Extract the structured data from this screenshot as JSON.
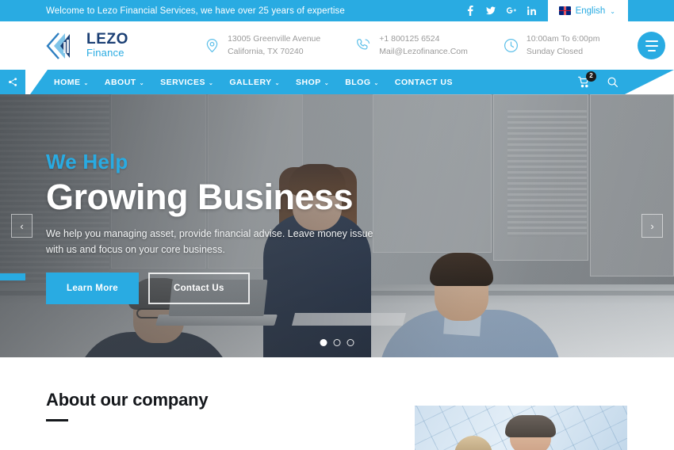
{
  "topbar": {
    "welcome": "Welcome to Lezo Financial Services, we have over 25 years of expertise",
    "social": [
      {
        "name": "facebook-icon",
        "label": "f"
      },
      {
        "name": "twitter-icon",
        "label": "t"
      },
      {
        "name": "google-plus-icon",
        "label": "g+"
      },
      {
        "name": "linkedin-icon",
        "label": "in"
      }
    ],
    "language": "English",
    "language_caret": "⌄",
    "accent_color": "#29ABE2"
  },
  "header": {
    "logo": {
      "name": "LEZO",
      "sub": "Finance"
    },
    "contacts": [
      {
        "icon": "location-pin-icon",
        "line1": "13005 Greenville Avenue",
        "line2": "California, TX 70240"
      },
      {
        "icon": "phone-icon",
        "line1": "+1 800125 6524",
        "line2": "Mail@Lezofinance.Com"
      },
      {
        "icon": "clock-icon",
        "line1": "10:00am To 6:00pm",
        "line2": "Sunday Closed"
      }
    ]
  },
  "nav": {
    "items": [
      {
        "label": "HOME",
        "caret": "⌄"
      },
      {
        "label": "ABOUT",
        "caret": "⌄"
      },
      {
        "label": "SERVICES",
        "caret": "⌄"
      },
      {
        "label": "GALLERY",
        "caret": "⌄"
      },
      {
        "label": "SHOP",
        "caret": "⌄"
      },
      {
        "label": "BLOG",
        "caret": "⌄"
      },
      {
        "label": "CONTACT US",
        "caret": ""
      }
    ],
    "cart_count": "2"
  },
  "hero": {
    "kicker": "We Help",
    "title": "Growing Business",
    "description": "We help you managing asset, provide financial advise. Leave money issue with us and focus on your core business.",
    "primary_button": "Learn More",
    "secondary_button": "Contact Us",
    "arrow_prev": "‹",
    "arrow_next": "›",
    "slides": 3,
    "active_slide": 1
  },
  "about": {
    "title": "About our company"
  }
}
